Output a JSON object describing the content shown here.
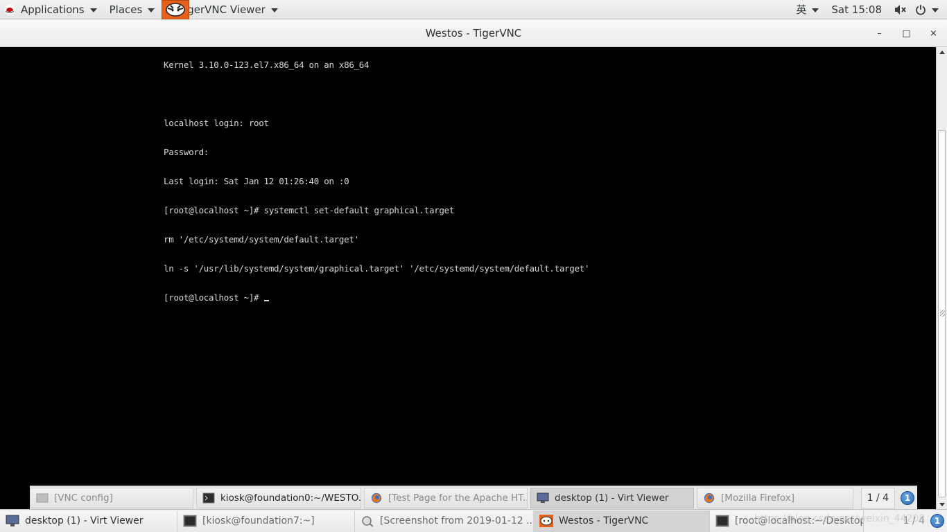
{
  "top_panel": {
    "applications_label": "Applications",
    "places_label": "Places",
    "active_app_label": "TigerVNC Viewer",
    "input_method": "英",
    "clock": "Sat 15:08"
  },
  "window": {
    "title": "Westos - TigerVNC",
    "minimize": "–",
    "maximize": "□",
    "close": "×"
  },
  "console": {
    "lines": [
      "Kernel 3.10.0-123.el7.x86_64 on an x86_64",
      "",
      "localhost login: root",
      "Password:",
      "Last login: Sat Jan 12 01:26:40 on :0",
      "[root@localhost ~]# systemctl set-default graphical.target",
      "rm '/etc/systemd/system/default.target'",
      "ln -s '/usr/lib/systemd/system/graphical.target' '/etc/systemd/system/default.target'",
      "[root@localhost ~]# "
    ]
  },
  "inner_taskbar": {
    "items": [
      {
        "label": "[VNC config]",
        "icon": "window-icon"
      },
      {
        "label": "kiosk@foundation0:~/WESTO...",
        "icon": "terminal-icon"
      },
      {
        "label": "[Test Page for the Apache HT...",
        "icon": "firefox-icon"
      },
      {
        "label": "desktop (1) - Virt Viewer",
        "icon": "monitor-icon"
      },
      {
        "label": "[Mozilla Firefox]",
        "icon": "firefox-icon"
      }
    ],
    "pager": "1 / 4",
    "badge": "1"
  },
  "host_taskbar": {
    "items": [
      {
        "label": "desktop (1) - Virt Viewer",
        "icon": "monitor-icon"
      },
      {
        "label": "[kiosk@foundation7:~]",
        "icon": "terminal-icon"
      },
      {
        "label": "[Screenshot from 2019-01-12 ...",
        "icon": "screenshot-icon"
      },
      {
        "label": "Westos - TigerVNC",
        "icon": "tigervnc-icon"
      },
      {
        "label": "[root@localhost:~/Desktop]",
        "icon": "terminal-icon"
      }
    ],
    "pager": "1 / 4",
    "badge": "1"
  },
  "watermark": "https://blog.csdn.net/weixin_44208"
}
